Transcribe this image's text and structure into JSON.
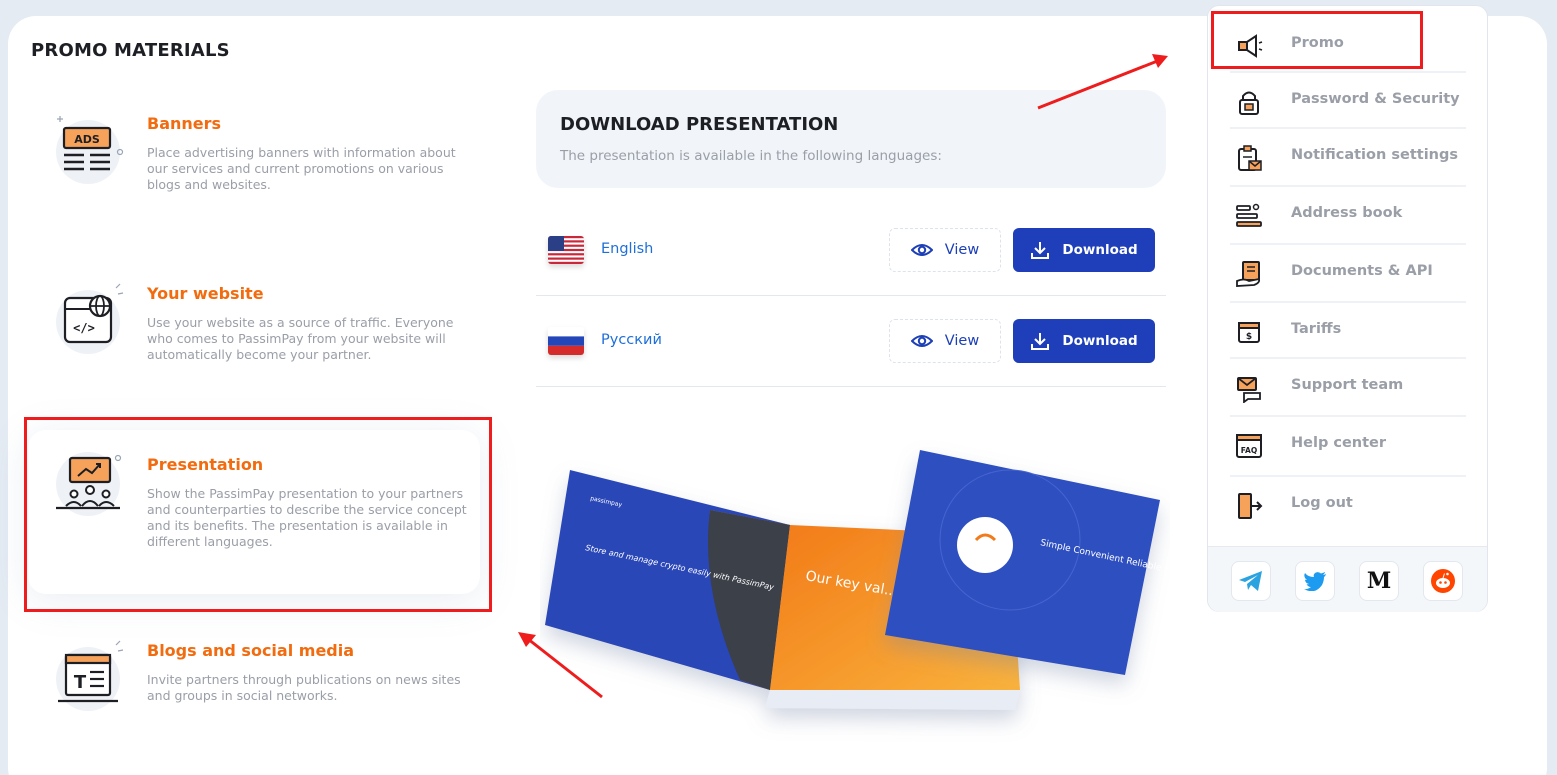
{
  "page": {
    "title": "PROMO MATERIALS"
  },
  "promo_items": [
    {
      "title": "Banners",
      "icon": "ads-banner-icon",
      "description": "Place advertising banners with information about our services and current promotions on various blogs and websites."
    },
    {
      "title": "Your website",
      "icon": "website-code-icon",
      "description": "Use your website as a source of traffic. Everyone who comes to PassimPay from your website will automatically become your partner."
    },
    {
      "title": "Presentation",
      "icon": "presentation-icon",
      "description": "Show the PassimPay presentation to your partners and counterparties to describe the service concept and its benefits. The presentation is available in different languages."
    },
    {
      "title": "Blogs and social media",
      "icon": "blog-text-icon",
      "description": "Invite partners through publications on news sites and groups in social networks."
    }
  ],
  "download": {
    "heading": "DOWNLOAD PRESENTATION",
    "subtitle": "The presentation is available in the following languages:",
    "languages": [
      {
        "name": "English",
        "flag": "us-flag-icon",
        "view_label": "View",
        "download_label": "Download"
      },
      {
        "name": "Русский",
        "flag": "ru-flag-icon",
        "view_label": "View",
        "download_label": "Download"
      }
    ],
    "book_texts": {
      "brand": "passimpay",
      "left_page": "Store and manage crypto easily with PassimPay",
      "middle_page": "Our key val... mission",
      "cover": "Simple Convenient Reliable For any Purpose"
    }
  },
  "menu": {
    "items": [
      {
        "label": "Promo",
        "icon": "megaphone-icon"
      },
      {
        "label": "Password & Security",
        "icon": "lock-icon"
      },
      {
        "label": "Notification settings",
        "icon": "clipboard-mail-icon"
      },
      {
        "label": "Address book",
        "icon": "address-list-icon"
      },
      {
        "label": "Documents & API",
        "icon": "document-hand-icon"
      },
      {
        "label": "Tariffs",
        "icon": "dollar-bill-icon"
      },
      {
        "label": "Support team",
        "icon": "chat-mail-icon"
      },
      {
        "label": "Help center",
        "icon": "faq-icon"
      },
      {
        "label": "Log out",
        "icon": "door-exit-icon"
      }
    ],
    "social": [
      {
        "name": "telegram",
        "icon": "telegram-icon"
      },
      {
        "name": "twitter",
        "icon": "twitter-icon"
      },
      {
        "name": "medium",
        "icon": "medium-icon",
        "glyph": "M"
      },
      {
        "name": "reddit",
        "icon": "reddit-icon"
      }
    ]
  },
  "colors": {
    "accent_orange": "#f26b0f",
    "primary_blue": "#1e3fb9",
    "link_blue": "#1e6fd9",
    "annotation_red": "#ee1c1c",
    "muted_text": "#9a9ea7"
  }
}
